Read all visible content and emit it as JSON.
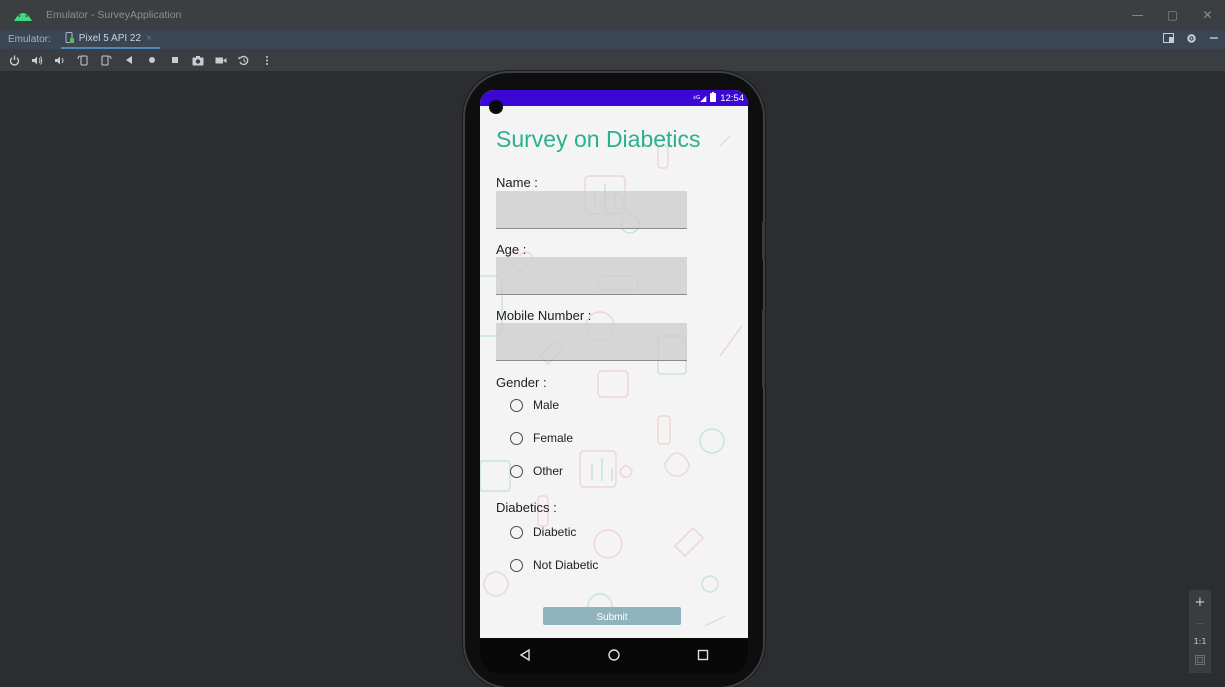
{
  "window": {
    "title": "Emulator - SurveyApplication",
    "controls": [
      "—",
      "▢",
      "✕"
    ]
  },
  "tabs": {
    "label": "Emulator:",
    "device_tab": "Pixel 5 API 22",
    "close": "×"
  },
  "toolbar": {
    "icons": [
      "power-icon",
      "volume-up-icon",
      "volume-down-icon",
      "rotate-left-icon",
      "rotate-right-icon",
      "back-icon",
      "home-icon",
      "overview-icon",
      "screenshot-icon",
      "screenrecord-icon",
      "snapshot-icon",
      "more-icon"
    ]
  },
  "device": {
    "status": {
      "signal": "⁴ᴳ◢",
      "battery_icon": "battery-icon",
      "time": "12:54"
    },
    "app": {
      "title": "Survey on Diabetics",
      "name_label": "Name :",
      "age_label": "Age :",
      "mobile_label": "Mobile Number :",
      "gender_label": "Gender :",
      "gender_options": [
        "Male",
        "Female",
        "Other"
      ],
      "diabetics_label": "Diabetics :",
      "diabetics_options": [
        "Diabetic",
        "Not Diabetic"
      ],
      "submit_label": "Submit"
    },
    "nav": [
      "back-icon",
      "home-icon",
      "recents-icon"
    ]
  },
  "zoom": {
    "plus": "+",
    "minus": "—",
    "one_to_one": "1:1"
  },
  "colors": {
    "accent": "#2bb08f",
    "statusbar": "#3b07d4",
    "submit": "#8fb4bd"
  }
}
